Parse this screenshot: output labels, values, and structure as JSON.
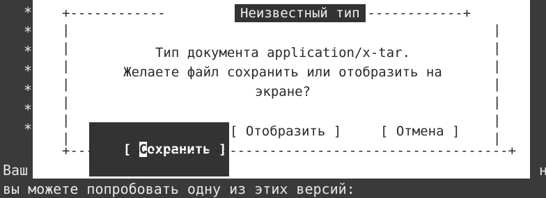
{
  "background": {
    "star_glyph": "*",
    "left_fragment": "Ваш",
    "right_fragment": "н",
    "bottom_line": "вы можете попробовать одну из этих версий:"
  },
  "dialog": {
    "title": "Неизвестный тип",
    "message_line_1": "Тип документа application/x-tar.",
    "message_line_2": "Желаете файл сохранить или отобразить на",
    "message_line_3": "экране?",
    "buttons": {
      "save_open": "[ ",
      "save_first_letter": "С",
      "save_rest": "охранить ]",
      "show": "[ Отобразить ]",
      "cancel": "[ Отмена ]"
    }
  },
  "colors": {
    "terminal_bg": "#3a3a3a",
    "dialog_bg": "#ffffff",
    "title_bg": "#333333"
  }
}
